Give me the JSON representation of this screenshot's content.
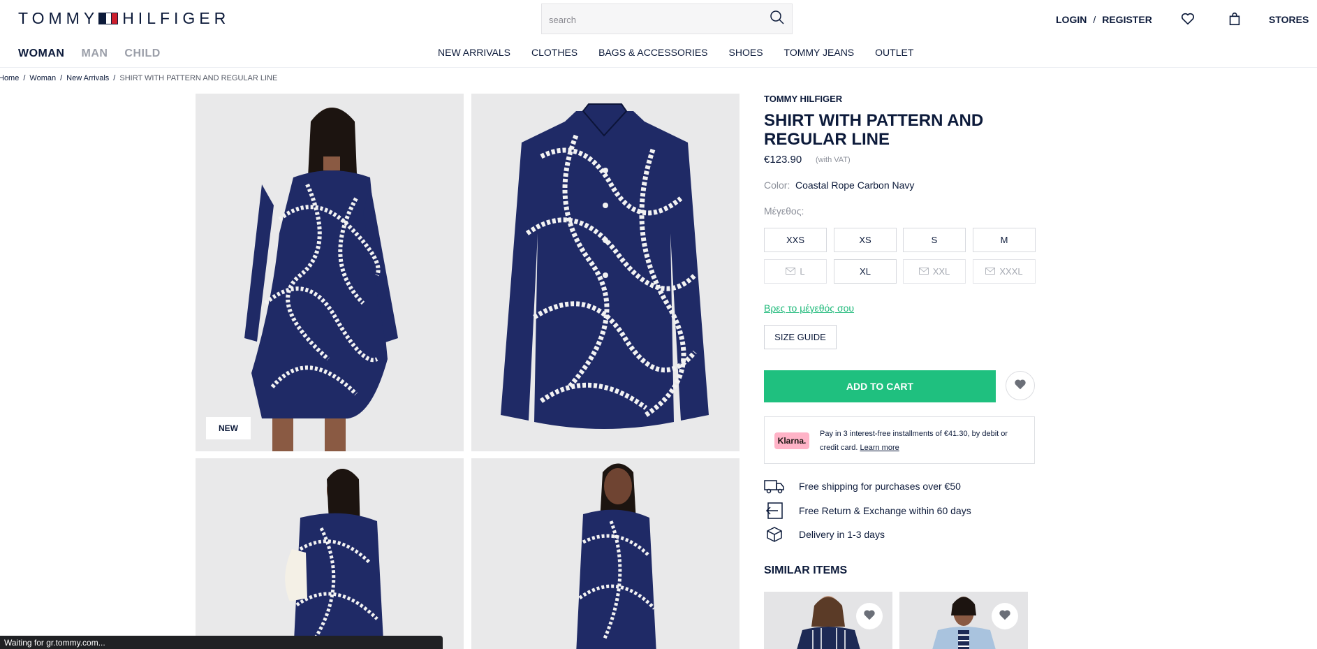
{
  "header": {
    "logo_left": "TOMMY",
    "logo_right": "HILFIGER",
    "search_placeholder": "search",
    "login": "LOGIN",
    "separator": "/",
    "register": "REGISTER",
    "stores": "STORES"
  },
  "gender_nav": [
    "WOMAN",
    "MAN",
    "CHILD"
  ],
  "category_nav": [
    "NEW ARRIVALS",
    "CLOTHES",
    "BAGS & ACCESSORIES",
    "SHOES",
    "TOMMY JEANS",
    "OUTLET"
  ],
  "breadcrumb": {
    "items": [
      "Home",
      "Woman",
      "New Arrivals"
    ],
    "separator": "/",
    "current": "SHIRT WITH PATTERN AND REGULAR LINE"
  },
  "gallery": {
    "new_badge": "NEW"
  },
  "product": {
    "brand": "TOMMY HILFIGER",
    "title": "SHIRT WITH PATTERN AND REGULAR LINE",
    "price": "€123.90",
    "vat": "(with VAT)",
    "color_label": "Color:",
    "color_value": "Coastal Rope Carbon Navy",
    "size_label": "Μέγεθος:",
    "sizes": [
      {
        "label": "XXS",
        "available": true
      },
      {
        "label": "XS",
        "available": true
      },
      {
        "label": "S",
        "available": true
      },
      {
        "label": "M",
        "available": true
      },
      {
        "label": "L",
        "available": false
      },
      {
        "label": "XL",
        "available": true
      },
      {
        "label": "XXL",
        "available": false
      },
      {
        "label": "XXXL",
        "available": false
      }
    ],
    "find_size": "Βρες το μέγεθός σου",
    "size_guide": "SIZE GUIDE",
    "add_to_cart": "ADD TO CART"
  },
  "klarna": {
    "logo": "Klarna.",
    "text": "Pay in 3 interest-free installments of €41.30, by debit or credit card.",
    "link": "Learn more"
  },
  "perks": [
    {
      "icon": "truck-icon",
      "text": "Free shipping for purchases over €50"
    },
    {
      "icon": "return-icon",
      "text": "Free Return & Exchange within 60 days"
    },
    {
      "icon": "box-icon",
      "text": "Delivery in 1-3 days"
    }
  ],
  "similar": {
    "title": "SIMILAR ITEMS"
  },
  "status_bar": "Waiting for gr.tommy.com...",
  "colors": {
    "navy": "#0c1a3a",
    "accent_green": "#1fc07f",
    "flag_red": "#cd1f2d",
    "klarna_pink": "#ffb3c7"
  }
}
